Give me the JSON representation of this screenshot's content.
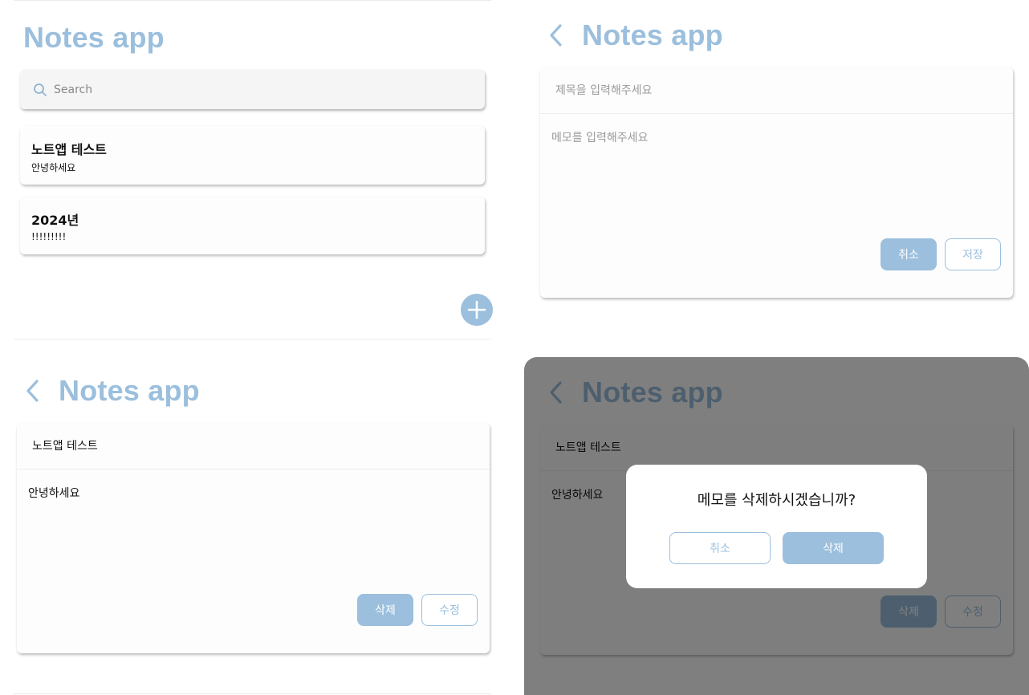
{
  "app_title": "Notes app",
  "colors": {
    "accent": "#9bbfdd",
    "overlay": "rgba(0,0,0,0.5)",
    "card": "#fdfdfd"
  },
  "list_screen": {
    "search": {
      "placeholder": "Search",
      "icon": "search-icon"
    },
    "notes": [
      {
        "title": "노트앱 테스트",
        "body": "안녕하세요"
      },
      {
        "title": "2024년",
        "body": "!!!!!!!!!"
      }
    ],
    "fab_icon": "plus-icon"
  },
  "new_note_screen": {
    "back_icon": "chevron-left-icon",
    "title_placeholder": "제목을 입력해주세요",
    "body_placeholder": "메모를 입력해주세요",
    "cancel_label": "취소",
    "save_label": "저장"
  },
  "detail_screen": {
    "back_icon": "chevron-left-icon",
    "title": "노트앱 테스트",
    "body": "안녕하세요",
    "delete_label": "삭제",
    "edit_label": "수정"
  },
  "confirm_screen": {
    "back_icon": "chevron-left-icon",
    "title": "노트앱 테스트",
    "body": "안녕하세요",
    "delete_label": "삭제",
    "edit_label": "수정",
    "dialog": {
      "message": "메모를 삭제하시겠습니까?",
      "cancel_label": "취소",
      "confirm_label": "삭제"
    }
  }
}
